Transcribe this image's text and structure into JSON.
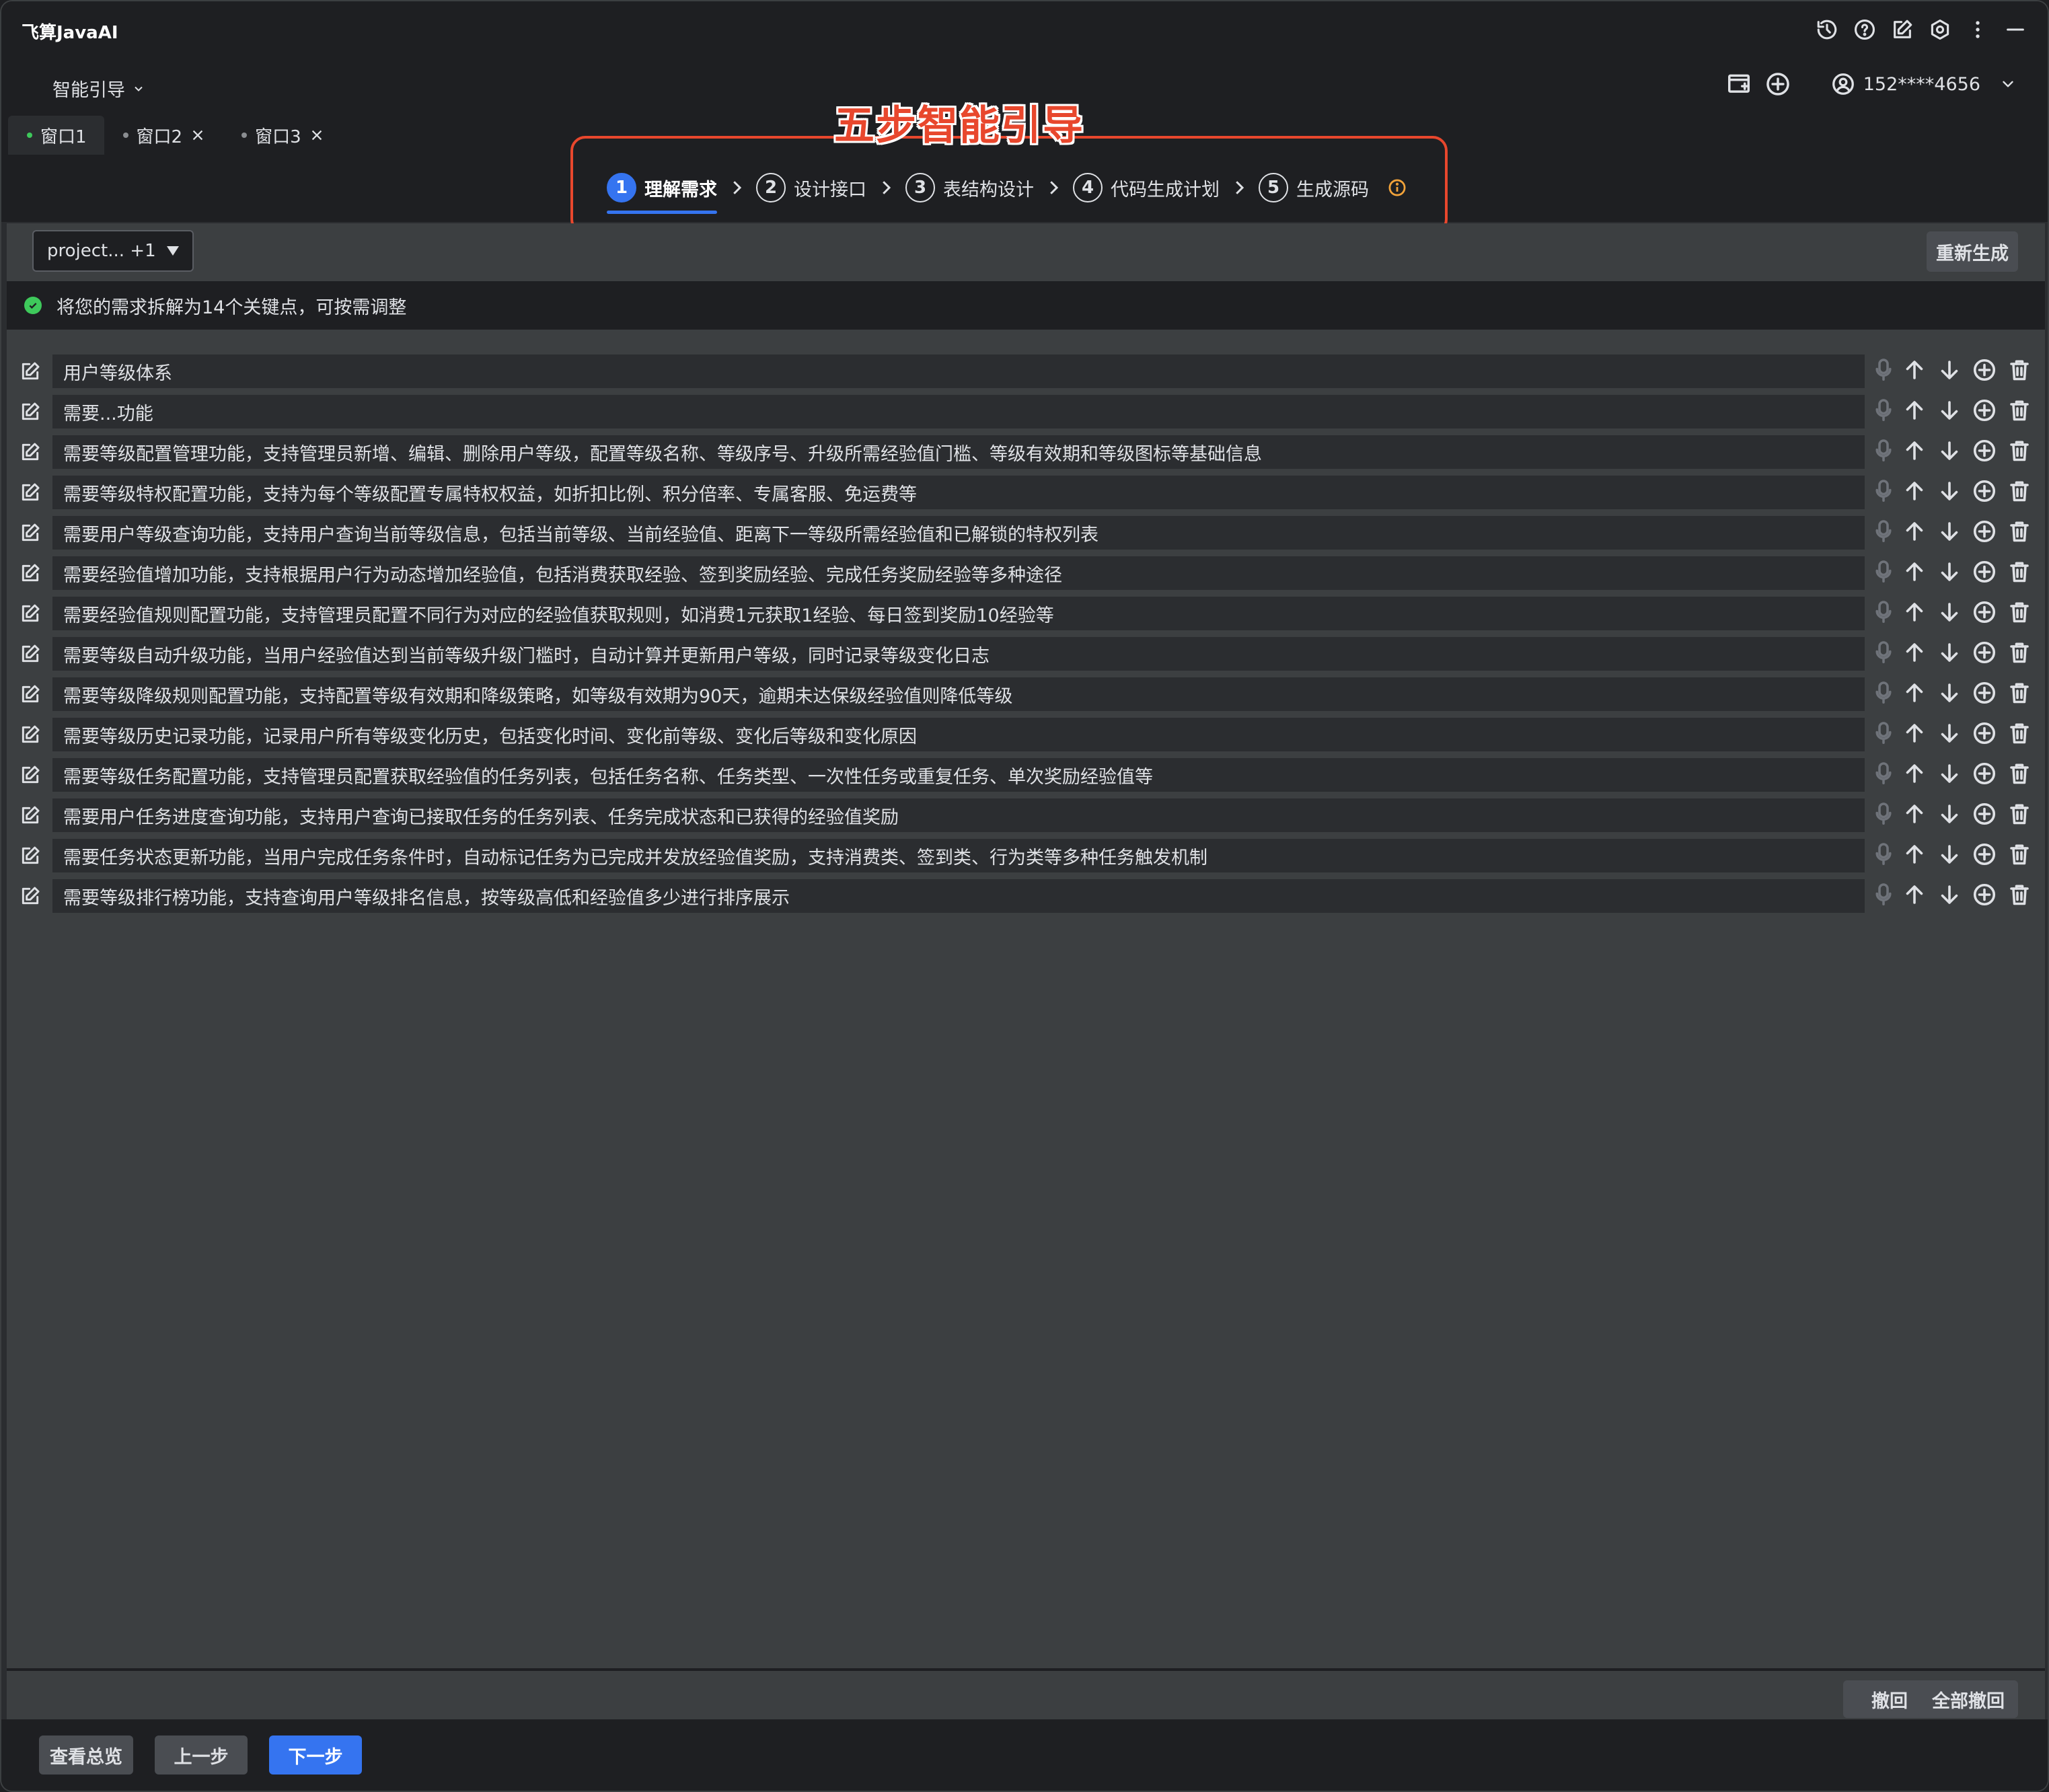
{
  "app": {
    "title": "飞算JavaAI"
  },
  "header": {
    "mode_label": "智能引导",
    "user_id": "152****4656",
    "icons": [
      "history-icon",
      "help-icon",
      "edit-icon",
      "settings-icon",
      "more-icon",
      "minimize-icon"
    ]
  },
  "tabs": [
    {
      "label": "窗口1",
      "active": true
    },
    {
      "label": "窗口2",
      "active": false
    },
    {
      "label": "窗口3",
      "active": false
    }
  ],
  "annotation": {
    "title": "五步智能引导",
    "color": "#e8472d"
  },
  "steps": [
    {
      "num": "1",
      "label": "理解需求",
      "active": true
    },
    {
      "num": "2",
      "label": "设计接口",
      "active": false
    },
    {
      "num": "3",
      "label": "表结构设计",
      "active": false
    },
    {
      "num": "4",
      "label": "代码生成计划",
      "active": false
    },
    {
      "num": "5",
      "label": "生成源码",
      "active": false
    }
  ],
  "toolbar": {
    "project_select": "project... +1",
    "regenerate_label": "重新生成"
  },
  "status": {
    "message": "将您的需求拆解为14个关键点，可按需调整"
  },
  "requirements": [
    "用户等级体系",
    "需要...功能",
    "需要等级配置管理功能，支持管理员新增、编辑、删除用户等级，配置等级名称、等级序号、升级所需经验值门槛、等级有效期和等级图标等基础信息",
    "需要等级特权配置功能，支持为每个等级配置专属特权权益，如折扣比例、积分倍率、专属客服、免运费等",
    "需要用户等级查询功能，支持用户查询当前等级信息，包括当前等级、当前经验值、距离下一等级所需经验值和已解锁的特权列表",
    "需要经验值增加功能，支持根据用户行为动态增加经验值，包括消费获取经验、签到奖励经验、完成任务奖励经验等多种途径",
    "需要经验值规则配置功能，支持管理员配置不同行为对应的经验值获取规则，如消费1元获取1经验、每日签到奖励10经验等",
    "需要等级自动升级功能，当用户经验值达到当前等级升级门槛时，自动计算并更新用户等级，同时记录等级变化日志",
    "需要等级降级规则配置功能，支持配置等级有效期和降级策略，如等级有效期为90天，逾期未达保级经验值则降低等级",
    "需要等级历史记录功能，记录用户所有等级变化历史，包括变化时间、变化前等级、变化后等级和变化原因",
    "需要等级任务配置功能，支持管理员配置获取经验值的任务列表，包括任务名称、任务类型、一次性任务或重复任务、单次奖励经验值等",
    "需要用户任务进度查询功能，支持用户查询已接取任务的任务列表、任务完成状态和已获得的经验值奖励",
    "需要任务状态更新功能，当用户完成任务条件时，自动标记任务为已完成并发放经验值奖励，支持消费类、签到类、行为类等多种任务触发机制",
    "需要等级排行榜功能，支持查询用户等级排名信息，按等级高低和经验值多少进行排序展示"
  ],
  "undo": {
    "undo_label": "撤回",
    "undo_all_label": "全部撤回"
  },
  "footer": {
    "overview_label": "查看总览",
    "prev_label": "上一步",
    "next_label": "下一步"
  },
  "colors": {
    "accent": "#3574f0",
    "success": "#3ec95b",
    "warning": "#f2a33a",
    "background": "#2b2d30"
  }
}
